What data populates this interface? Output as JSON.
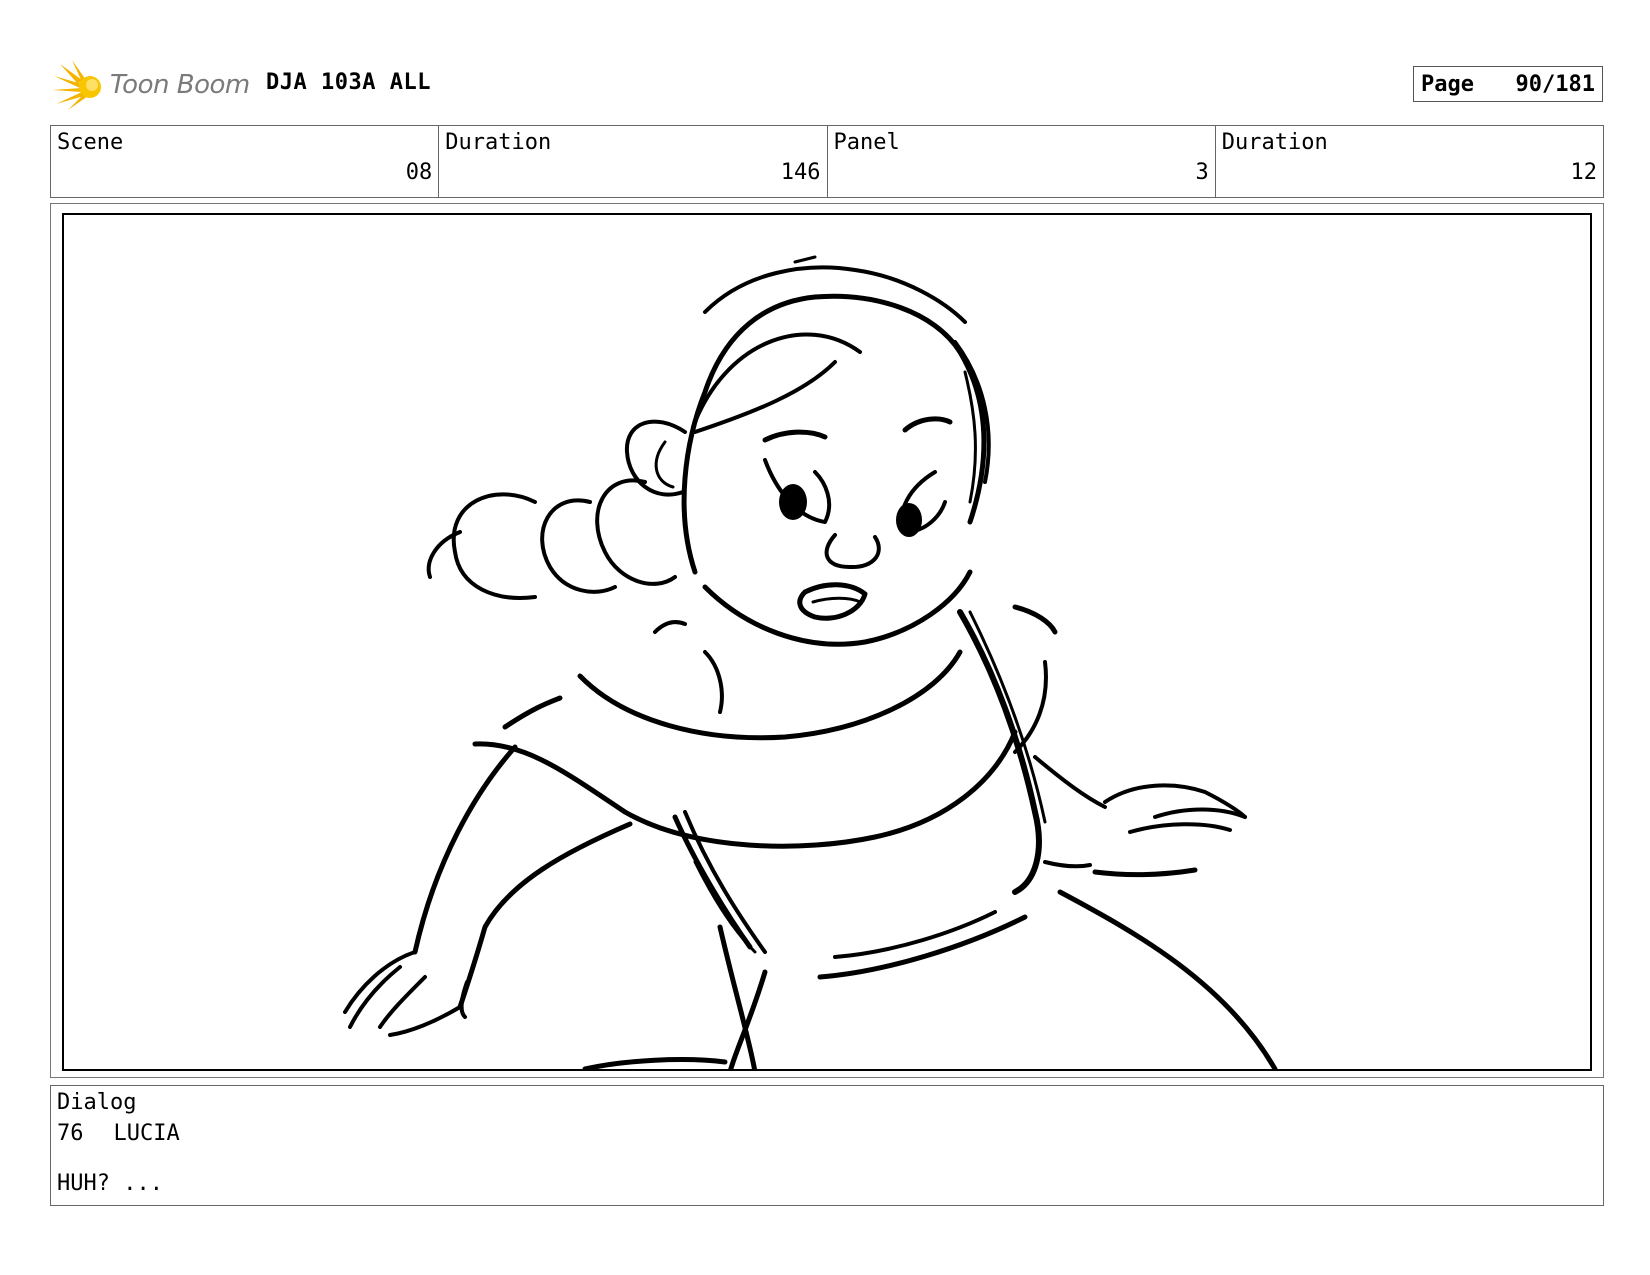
{
  "header": {
    "logo_text": "Toon Boom",
    "project": "DJA 103A ALL",
    "page_label": "Page",
    "page_value": "90/181"
  },
  "info": {
    "scene_label": "Scene",
    "scene_value": "08",
    "scene_duration_label": "Duration",
    "scene_duration_value": "146",
    "panel_label": "Panel",
    "panel_value": "3",
    "panel_duration_label": "Duration",
    "panel_duration_value": "12"
  },
  "dialog": {
    "label": "Dialog",
    "number": "76",
    "character": "LUCIA",
    "line": "HUH? ..."
  }
}
